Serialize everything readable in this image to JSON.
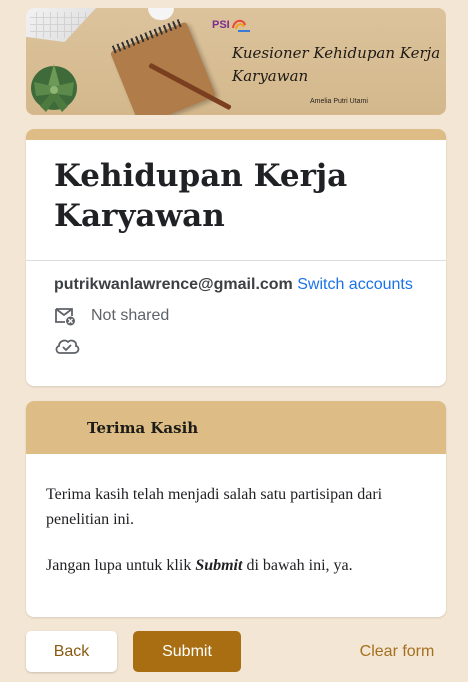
{
  "banner": {
    "title_line1": "Kuesioner Kehidupan Kerja",
    "title_line2": "Karyawan",
    "author": "Amelia Putri Utami",
    "logo_text": "PSI"
  },
  "form": {
    "title": "Kehidupan Kerja Karyawan",
    "email": "putrikwanlawrence@gmail.com",
    "switch_label": "Switch accounts",
    "not_shared_label": "Not shared"
  },
  "section": {
    "heading": "Terima Kasih",
    "paragraph1": "Terima kasih telah menjadi salah satu partisipan dari penelitian ini.",
    "paragraph2_before": "Jangan lupa untuk klik ",
    "paragraph2_bold": "Submit",
    "paragraph2_after": " di bawah ini, ya."
  },
  "buttons": {
    "back": "Back",
    "submit": "Submit",
    "clear": "Clear form"
  },
  "colors": {
    "accent": "#ddbd85",
    "submit": "#a86e11",
    "link": "#1a73e8",
    "background": "#f3e6d4"
  },
  "icons": {
    "mail": "mail-not-shared-icon",
    "cloud": "cloud-done-icon"
  }
}
